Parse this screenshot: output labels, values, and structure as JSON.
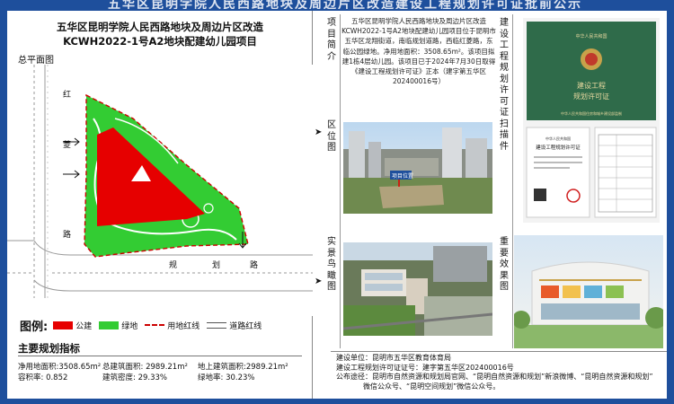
{
  "banner": {
    "text": "五华区昆明学院人民西路地块及周边片区改造建设工程规划许可证批前公示"
  },
  "project": {
    "title_line1": "五华区昆明学院人民西路地块及周边片区改造",
    "title_line2": "KCWH2022-1号A2地块配建幼儿园项目"
  },
  "map": {
    "label": "总平面图",
    "road_left_chars": [
      "红",
      "菱",
      "路"
    ],
    "road_bottom_chars": [
      "规",
      "划",
      "路"
    ]
  },
  "legend": {
    "title": "图例:",
    "items": [
      {
        "label": "公建",
        "color": "#e60000"
      },
      {
        "label": "绿地",
        "color": "#33cc33"
      },
      {
        "label": "用地红线",
        "color": "#cc0000"
      },
      {
        "label": "道路红线",
        "color": "#555555"
      }
    ]
  },
  "indicators": {
    "title": "主要规划指标",
    "net_area": "净用地面积:3508.65m²",
    "total_area": "总建筑面积: 2989.21m²",
    "above_area": "地上建筑面积:2989.21m²",
    "far": "容积率: 0.852",
    "density": "建筑密度: 29.33%",
    "green": "绿地率: 30.23%"
  },
  "labels": {
    "intro": "项目简介",
    "location": "区位图",
    "aerial": "实景鸟瞰图",
    "permit": "建设工程规划许可证扫描件",
    "render": "重要效果图"
  },
  "intro_text": "五华区昆明学院人民西路地块及周边片区改造KCWH2022-1号A2地块配建幼儿园项目位于昆明市五华区龙翔街道，南临规划道路，西临红菱路，东临公园绿地。净用地面积：3508.65m²。该项目拟建1栋4层幼儿园。该项目已于2024年7月30日取得《建设工程规划许可证》正本（建字第五华区202400016号）",
  "location_photo": {
    "tag": "项目位置"
  },
  "permit": {
    "cover_line1": "中华人民共和国",
    "cover_line2": "建设工程",
    "cover_line3": "规划许可证",
    "cover_footer": "中华人民共和国住房和城乡建设部监制",
    "inner_country": "中华人民共和国",
    "inner_title": "建设工程规划许可证"
  },
  "bottom": {
    "unit": "建设单位：昆明市五华区教育体育局",
    "permit_no": "建设工程规划许可证证号：建字第五华区202400016号",
    "notice1": "公布途径：昆明市自然资源和规划局官网、“昆明自然资源和规划”新浪微博、“昆明自然资源和规划”",
    "notice2": "微信公众号、“昆明空间规划”微信公众号。"
  }
}
